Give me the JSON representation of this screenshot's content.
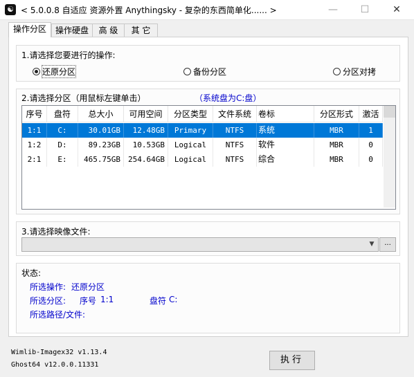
{
  "window": {
    "title": "< 5.0.0.8 自适应 资源外置 Anythingsky - 复杂的东西简单化...... >",
    "icon": "yin-yang-icon",
    "minimize": "—",
    "maximize": "☐",
    "close": "✕"
  },
  "tabs": [
    {
      "label": "操作分区",
      "active": true
    },
    {
      "label": "操作硬盘",
      "active": false
    },
    {
      "label": "高 级",
      "active": false
    },
    {
      "label": "其 它",
      "active": false
    }
  ],
  "operation": {
    "label": "1.请选择您要进行的操作:",
    "options": [
      {
        "label": "还原分区",
        "selected": true
      },
      {
        "label": "备份分区",
        "selected": false
      },
      {
        "label": "分区对拷",
        "selected": false
      }
    ]
  },
  "partition": {
    "label": "2.请选择分区（用鼠标左键单击）",
    "system_hint": "（系统盘为C:盘）",
    "columns": [
      "序号",
      "盘符",
      "总大小",
      "可用空间",
      "分区类型",
      "文件系统",
      "卷标",
      "分区形式",
      "激活"
    ],
    "rows": [
      {
        "id": "1:1",
        "drive": "C:",
        "total": "30.01GB",
        "free": "12.48GB",
        "type": "Primary",
        "fs": "NTFS",
        "label": "系统",
        "scheme": "MBR",
        "active": "1",
        "selected": true
      },
      {
        "id": "1:2",
        "drive": "D:",
        "total": "89.23GB",
        "free": "10.53GB",
        "type": "Logical",
        "fs": "NTFS",
        "label": "软件",
        "scheme": "MBR",
        "active": "0",
        "selected": false
      },
      {
        "id": "2:1",
        "drive": "E:",
        "total": "465.75GB",
        "free": "254.64GB",
        "type": "Logical",
        "fs": "NTFS",
        "label": "综合",
        "scheme": "MBR",
        "active": "0",
        "selected": false
      }
    ]
  },
  "image_file": {
    "label": "3.请选择映像文件:",
    "value": "",
    "dropdown_icon": "▼",
    "browse_label": "..."
  },
  "status": {
    "label": "状态:",
    "op_label": "所选操作:",
    "op_value": "还原分区",
    "part_label": "所选分区:",
    "part_id_label": "序号",
    "part_id": "1:1",
    "part_drive_label": "盘符",
    "part_drive": "C:",
    "path_label": "所选路径/文件:"
  },
  "footer": {
    "wimlib": "Wimlib-Imagex32 v1.13.4",
    "ghost": "Ghost64 v12.0.0.11331",
    "execute_label": "执行"
  }
}
